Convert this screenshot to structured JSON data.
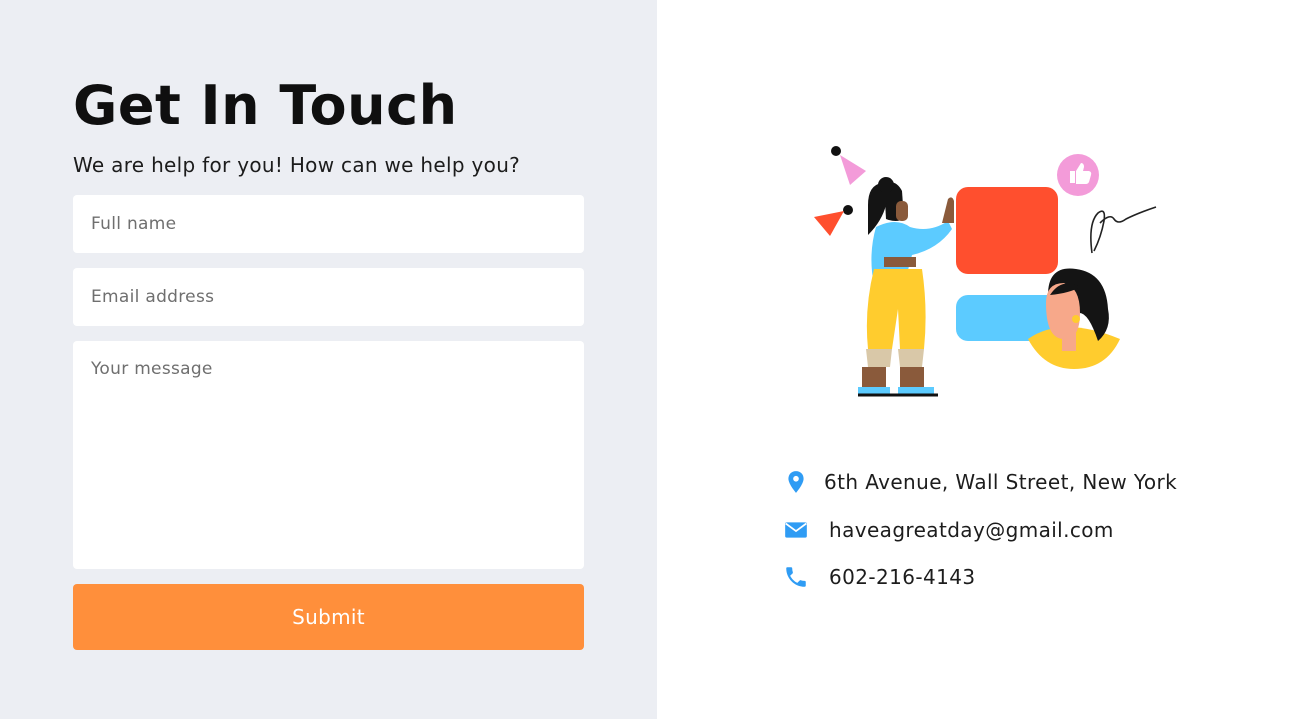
{
  "form": {
    "title": "Get In Touch",
    "subtitle": "We are help for you! How can we help you?",
    "name_placeholder": "Full name",
    "email_placeholder": "Email address",
    "message_placeholder": "Your message",
    "submit_label": "Submit"
  },
  "contact": {
    "address": "6th Avenue, Wall Street, New York",
    "email": "haveagreatday@gmail.com",
    "phone": "602-216-4143",
    "address_icon": "location-pin-icon",
    "email_icon": "envelope-icon",
    "phone_icon": "phone-icon"
  },
  "colors": {
    "left_background": "#eceef3",
    "submit_button": "#ff8f3b",
    "icon_accent": "#2f9cf4"
  }
}
